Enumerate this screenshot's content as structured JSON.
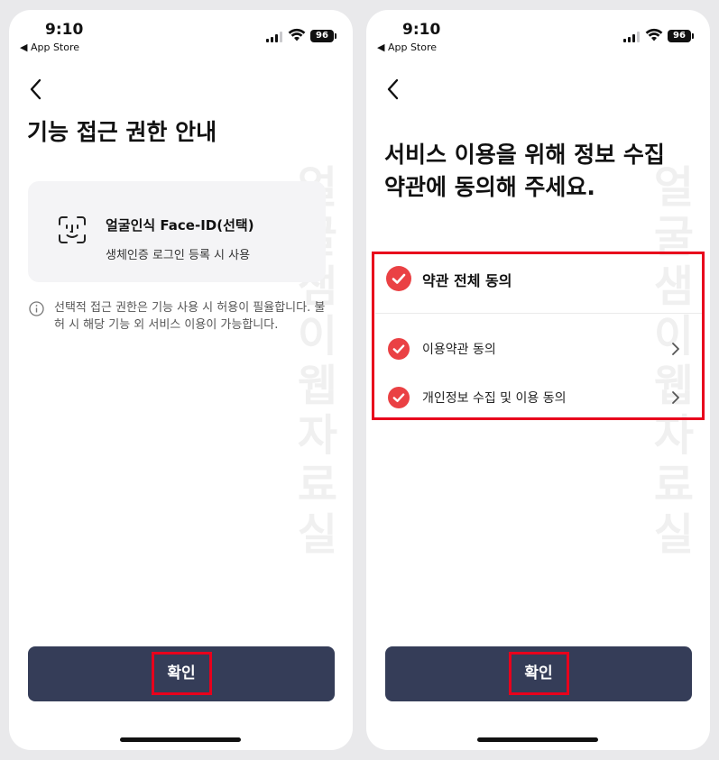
{
  "status": {
    "time": "9:10",
    "back_app": "◀ App Store",
    "battery": "96"
  },
  "left": {
    "title": "기능 접근 권한 안내",
    "permission": {
      "title": "얼굴인식 Face-ID(선택)",
      "description": "생체인증 로그인 등록 시 사용"
    },
    "note": "선택적 접근 권한은 기능 사용 시 허용이 필율합니다. 불허 시 해당 기능 외 서비스 이용이 가능합니다.",
    "confirm_label": "확인"
  },
  "right": {
    "title_line1": "서비스 이용을 위해 정보 수집",
    "title_line2": "약관에 동의해 주세요.",
    "agree_all": "약관 전체 동의",
    "terms": [
      {
        "label": "이용약관 동의"
      },
      {
        "label": "개인정보 수집 및 이용 동의"
      }
    ],
    "confirm_label": "확인"
  },
  "watermark": "얼굴샘이웹자료실",
  "colors": {
    "accent_check": "#ea4144",
    "button": "#353d58",
    "highlight": "#e8001c"
  },
  "icons": {
    "back": "chevron-left-icon",
    "face_id": "face-id-icon",
    "info": "info-icon",
    "check": "check-circle-icon",
    "chevron": "chevron-right-icon"
  }
}
